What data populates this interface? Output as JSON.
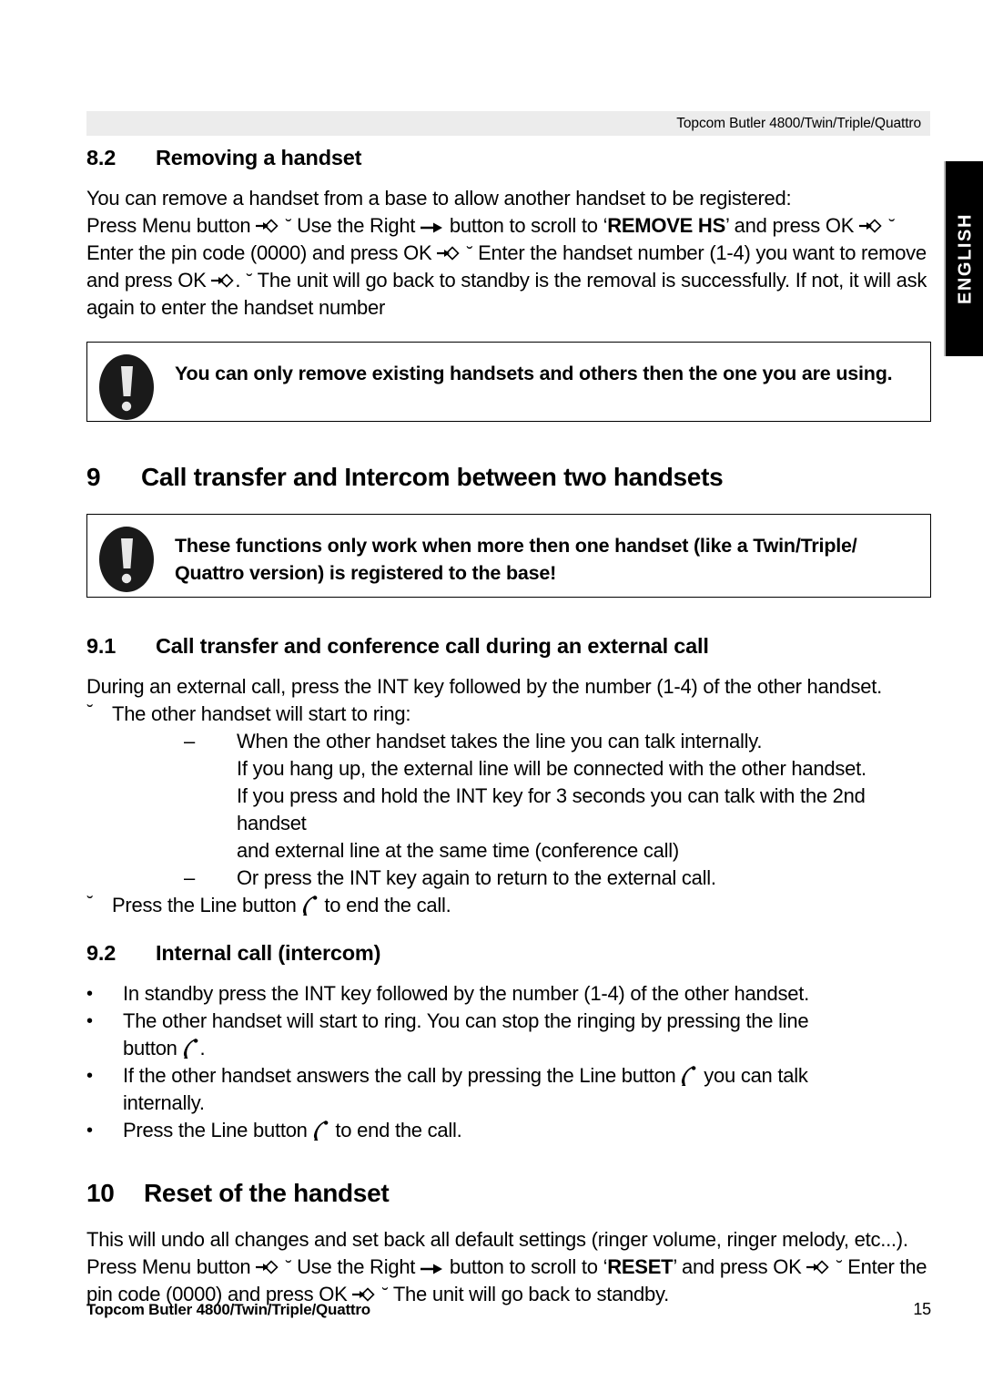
{
  "document": {
    "running_header": "Topcom Butler 4800/Twin/Triple/Quattro",
    "language_tab": "ENGLISH",
    "footer_left": "Topcom Butler 4800/Twin/Triple/Quattro",
    "footer_page": "15"
  },
  "icons": {
    "menu_button": "menu-button-icon",
    "right_arrow": "right-arrow-icon",
    "phone_line": "phone-line-icon",
    "warning": "warning-exclamation-icon",
    "breve_marker": "˘",
    "dash_marker": "–",
    "bullet_marker": "•"
  },
  "section_8_2": {
    "number": "8.2",
    "title": "Removing a handset",
    "intro": "You can remove a handset from a base to allow another handset to be registered:",
    "steps": {
      "p1_a": "Press Menu button",
      "p1_b": "Use the Right",
      "p1_c": "button to scroll to ‘",
      "p1_bold": "REMOVE HS",
      "p1_d": "’ and press OK",
      "p2_a": "Enter the pin code (0000) and press OK",
      "p2_b": "Enter the handset number (1-4) you",
      "p3_a": "want to remove and press OK",
      "p3_b": ". ",
      "p3_c": "The unit will go back to standby is the removal is",
      "p4": "successfully. If not, it will ask again to enter the handset number"
    },
    "warning": "You can only remove existing handsets and others then the one you are using."
  },
  "section_9": {
    "number": "9",
    "title": "Call transfer and Intercom between two handsets",
    "warning": "These functions only work when more then one handset (like a Twin/Triple/ Quattro version) is registered to the base!"
  },
  "section_9_1": {
    "number": "9.1",
    "title": "Call transfer and conference call during an external call",
    "intro": "During an external call, press the INT key followed by the number (1-4) of the other handset.",
    "item_ring": "The other handset will start to ring:",
    "sub_items": [
      "When the other handset takes the line you can talk internally.",
      "Or press the INT key again to return to the external call."
    ],
    "continuation": [
      "If you hang up, the external line will be connected with the other handset.",
      "If you press and hold the INT key for 3 seconds you can talk with the 2nd handset",
      "and external line at the same time (conference call)"
    ],
    "end_call_a": "Press the Line button",
    "end_call_b": "to end the call."
  },
  "section_9_2": {
    "number": "9.2",
    "title": "Internal call (intercom)",
    "bullet_1": "In standby press the INT key followed by the number (1-4) of the other handset.",
    "bullet_2_a": "The other handset will start to ring. You can stop the ringing by pressing the line",
    "bullet_2_b": "button",
    "bullet_2_c": ".",
    "bullet_3_a": "If the other handset answers the call by pressing the Line button",
    "bullet_3_b": "you can talk",
    "bullet_3_c": "internally.",
    "bullet_4_a": "Press the Line button",
    "bullet_4_b": "to end the call."
  },
  "section_10": {
    "number": "10",
    "title": "Reset of the handset",
    "para_1": "This will undo all changes and set back all default settings (ringer volume, ringer melody,",
    "para_2": "etc...).",
    "steps": {
      "p1_a": "Press Menu button",
      "p1_b": "Use the Right",
      "p1_c": "button to scroll to ‘",
      "p1_bold": "RESET",
      "p1_d": "’ and press OK",
      "p2_a": "Enter the pin code (0000) and press OK",
      "p2_b": "The unit will go back to standby."
    }
  }
}
